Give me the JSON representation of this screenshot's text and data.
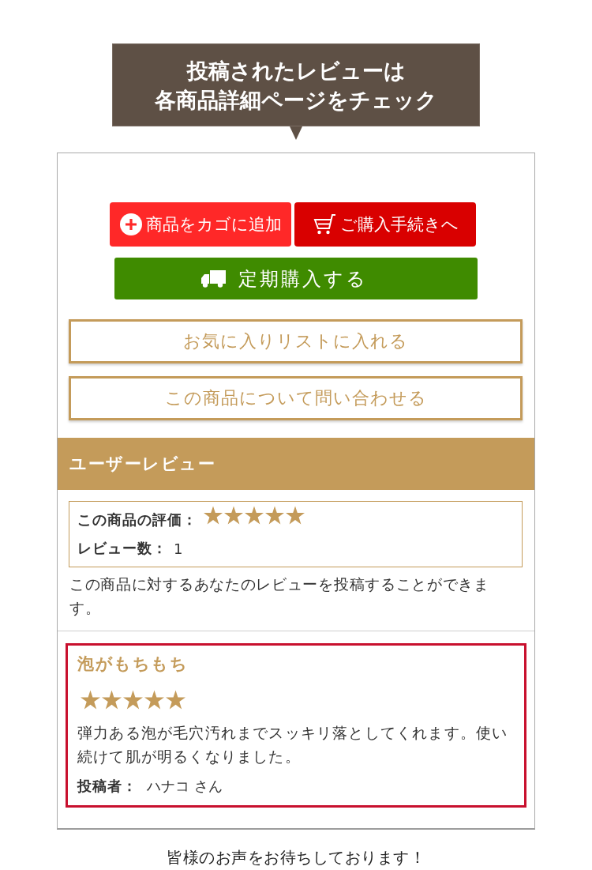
{
  "banner": {
    "lines": [
      "投稿されたレビューは",
      "各商品詳細ページをチェック"
    ]
  },
  "purchase_buttons": [
    {
      "kind": "add_to_cart",
      "label": "商品をカゴに追加"
    },
    {
      "kind": "checkout",
      "label": "ご購入手続きへ"
    }
  ],
  "subscription_button": {
    "label": "定期購入する"
  },
  "outline_buttons": [
    {
      "label": "お気に入りリストに入れる"
    },
    {
      "label": "この商品について問い合わせる"
    }
  ],
  "reviews_section": {
    "title": "ユーザーレビュー",
    "summary": {
      "rating_label": "この商品の評価：",
      "stars": 5,
      "count_label": "レビュー数：",
      "count": "1"
    },
    "note": "この商品に対するあなたのレビューを投稿することができます。",
    "reviews": [
      {
        "title": "泡がもちもち",
        "stars": 5,
        "body": "弾力ある泡が毛穴汚れまでスッキリ落としてくれます。使い続けて肌が明るくなりました。",
        "author_label": "投稿者：",
        "author": "ハナコ さん"
      }
    ]
  },
  "footer": {
    "message": "皆様のお声をお待ちしております！"
  }
}
